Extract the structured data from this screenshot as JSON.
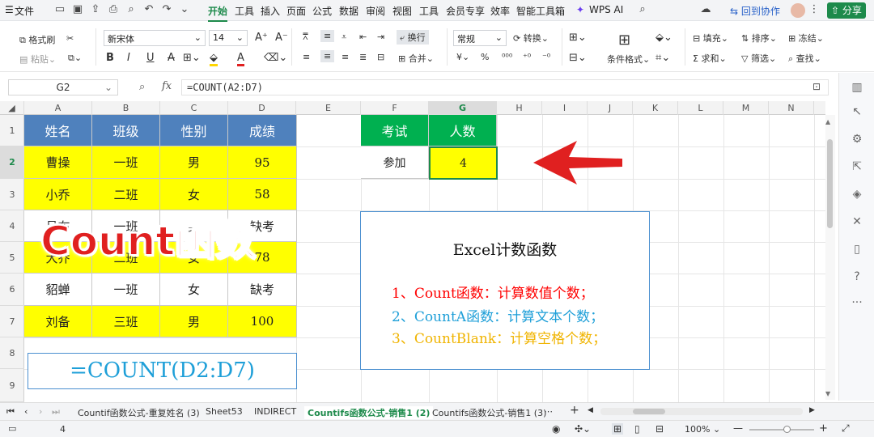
{
  "menubar": {
    "file": "文件",
    "tabs": [
      "开始",
      "工具",
      "插入",
      "页面",
      "公式",
      "数据",
      "审阅",
      "视图",
      "工具",
      "会员专享",
      "效率",
      "智能工具箱"
    ],
    "wps_ai": "WPS AI",
    "collab": "回到协作",
    "share": "分享"
  },
  "ribbon": {
    "format_painter": "格式刷",
    "paste": "粘贴",
    "font_name": "新宋体",
    "font_size": "14",
    "wrap": "换行",
    "merge": "合并",
    "number_format": "常规",
    "convert": "转换",
    "cond_format": "条件格式",
    "fill": "填充",
    "sort": "排序",
    "freeze": "冻结",
    "sum": "求和",
    "filter": "筛选",
    "find": "查找"
  },
  "formula_bar": {
    "cell_ref": "G2",
    "formula": "=COUNT(A2:D7)"
  },
  "columns": [
    "A",
    "B",
    "C",
    "D",
    "E",
    "F",
    "G",
    "H",
    "I",
    "J",
    "K",
    "L",
    "M",
    "N"
  ],
  "rows": [
    "1",
    "2",
    "3",
    "4",
    "5",
    "6",
    "7",
    "8",
    "9"
  ],
  "table": {
    "headers": [
      "姓名",
      "班级",
      "性别",
      "成绩"
    ],
    "rows": [
      [
        "曹操",
        "一班",
        "男",
        "95"
      ],
      [
        "小乔",
        "二班",
        "女",
        "58"
      ],
      [
        "吕布",
        "一班",
        "男",
        "缺考"
      ],
      [
        "大乔",
        "二班",
        "女",
        "78"
      ],
      [
        "貂蝉",
        "一班",
        "女",
        "缺考"
      ],
      [
        "刘备",
        "三班",
        "男",
        "100"
      ]
    ]
  },
  "summary": {
    "h1": "考试",
    "h2": "人数",
    "label": "参加",
    "value": "4"
  },
  "overlay_title": "Count函数",
  "formula_box": "=COUNT(D2:D7)",
  "info_box": {
    "title": "Excel计数函数",
    "lines": [
      "1、Count函数：计算数值个数；",
      "2、CountA函数：计算文本个数；",
      "3、CountBlank：计算空格个数；"
    ]
  },
  "sheet_tabs": [
    "Countif函数公式-重复姓名 (3)",
    "Sheet53",
    "INDIRECT",
    "Countifs函数公式-销售1 (2)",
    "Countifs函数公式-销售1 (3)"
  ],
  "status": {
    "count": "4",
    "zoom": "100%"
  },
  "colors": {
    "header_blue": "#4f81bd",
    "highlight_yellow": "#ffff00",
    "summary_green": "#00b050",
    "accent_red": "#e02020",
    "count_red": "#ff0000",
    "counta_blue": "#1e9fd8",
    "countblank_orange": "#f0b400"
  }
}
